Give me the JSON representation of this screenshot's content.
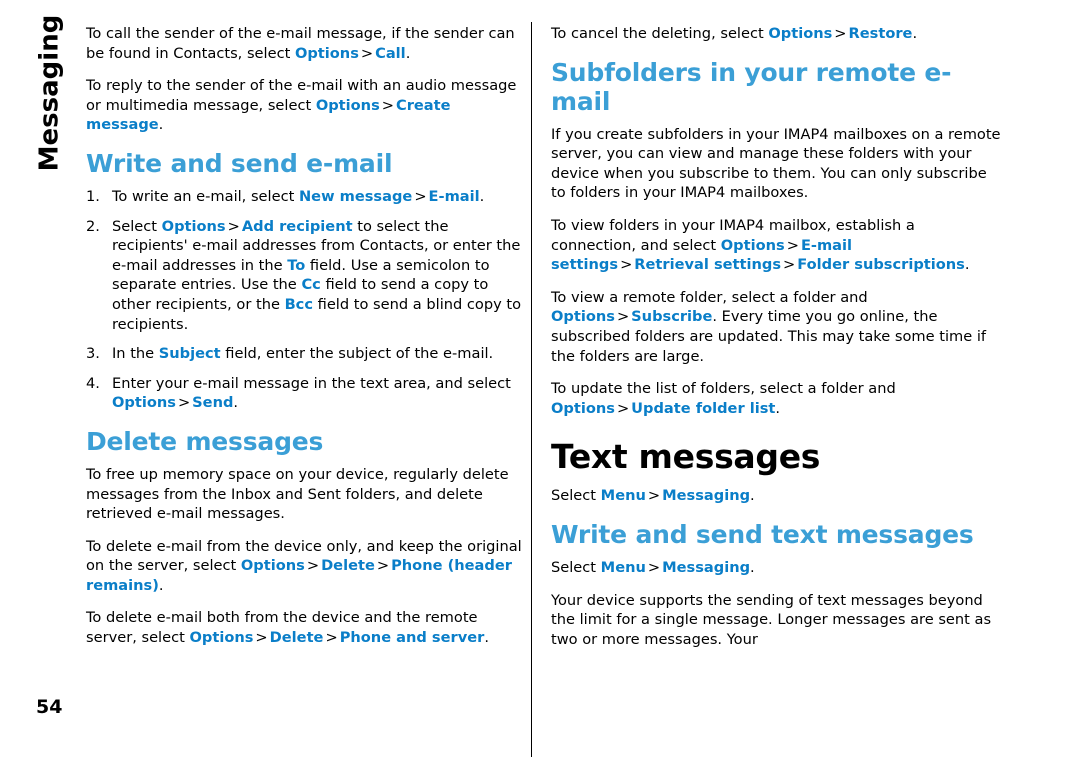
{
  "document": {
    "chapter_tab": "Messaging",
    "page_number": "54"
  },
  "left_column": {
    "para_call_sender": {
      "t1": "To call the sender of the e-mail message, if the sender can be found in Contacts, select ",
      "k1": "Options",
      "gt1": ">",
      "k2": "Call",
      "t2": "."
    },
    "para_reply_audio": {
      "t1": "To reply to the sender of the e-mail with an audio message or multimedia message, select ",
      "k1": "Options",
      "gt1": ">",
      "k2": "Create message",
      "t2": "."
    },
    "heading_write_send_email": "Write and send e-mail",
    "step1": {
      "t1": "To write an e-mail, select ",
      "k1": "New message",
      "gt1": ">",
      "k2": "E-mail",
      "t2": "."
    },
    "step2": {
      "t1": "Select ",
      "k1": "Options",
      "gt1": ">",
      "k2": "Add recipient",
      "t2": " to select the recipients' e-mail addresses from Contacts, or enter the e-mail addresses in the ",
      "k3": "To",
      "t3": " field. Use a semicolon to separate entries. Use the ",
      "k4": "Cc",
      "t4": " field to send a copy to other recipients, or the ",
      "k5": "Bcc",
      "t5": " field to send a blind copy to recipients."
    },
    "step3": {
      "t1": "In the ",
      "k1": "Subject",
      "t2": " field, enter the subject of the e-mail."
    },
    "step4": {
      "t1": "Enter your e-mail message in the text area, and select ",
      "k1": "Options",
      "gt1": ">",
      "k2": "Send",
      "t2": "."
    },
    "heading_delete_messages": "Delete messages",
    "para_free_memory": "To free up memory space on your device, regularly delete messages from the Inbox and Sent folders, and delete retrieved e-mail messages.",
    "para_delete_device_only": {
      "t1": "To delete e-mail from the device only, and keep the original on the server, select ",
      "k1": "Options",
      "gt1": ">",
      "k2": "Delete",
      "gt2": ">",
      "k3": "Phone (header remains)",
      "t2": "."
    },
    "para_delete_both": {
      "t1": "To delete e-mail both from the device and the remote server, select ",
      "k1": "Options",
      "gt1": ">",
      "k2": "Delete",
      "gt2": ">",
      "k3": "Phone and server",
      "t2": "."
    }
  },
  "right_column": {
    "para_cancel_delete": {
      "t1": "To cancel the deleting, select ",
      "k1": "Options",
      "gt1": ">",
      "k2": "Restore",
      "t2": "."
    },
    "heading_subfolders": "Subfolders in your remote e-mail",
    "para_imap_subfolders": "If you create subfolders in your IMAP4 mailboxes on a remote server, you can view and manage these folders with your device when you subscribe to them. You can only subscribe to folders in your IMAP4 mailboxes.",
    "para_view_folders": {
      "t1": "To view folders in your IMAP4 mailbox, establish a connection, and select ",
      "k1": "Options",
      "gt1": ">",
      "k2": "E-mail settings",
      "gt2": ">",
      "k3": "Retrieval settings",
      "gt3": ">",
      "k4": "Folder subscriptions",
      "t2": "."
    },
    "para_view_remote_folder": {
      "t1": "To view a remote folder, select a folder and ",
      "k1": "Options",
      "gt1": ">",
      "k2": "Subscribe",
      "t2": ". Every time you go online, the subscribed folders are updated. This may take some time if the folders are large."
    },
    "para_update_list": {
      "t1": "To update the list of folders, select a folder and ",
      "k1": "Options",
      "gt1": ">",
      "k2": "Update folder list",
      "t2": "."
    },
    "heading_text_messages": "Text messages",
    "para_select_menu_1": {
      "t1": "Select ",
      "k1": "Menu",
      "gt1": ">",
      "k2": "Messaging",
      "t2": "."
    },
    "heading_write_send_text": "Write and send text messages",
    "para_select_menu_2": {
      "t1": "Select ",
      "k1": "Menu",
      "gt1": ">",
      "k2": "Messaging",
      "t2": "."
    },
    "para_device_supports": "Your device supports the sending of text messages beyond the limit for a single message. Longer messages are sent as two or more messages. Your"
  }
}
